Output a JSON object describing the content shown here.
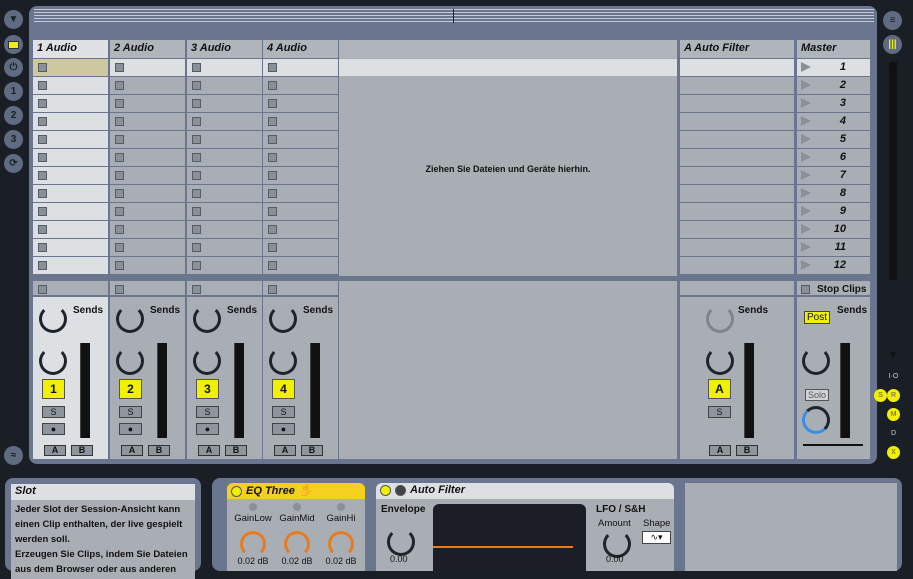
{
  "left_bar": {
    "icons": [
      "hide-browser-icon",
      "session-view-icon",
      "plugin-icon",
      "folder-1-icon",
      "folder-2-icon",
      "folder-3-icon",
      "sync-icon"
    ],
    "bottom_icon": "overview-wave-icon"
  },
  "right_bar": {
    "icons": [
      "arrangement-view-icon",
      "session-view-icon"
    ]
  },
  "tracks": [
    {
      "name": "1 Audio",
      "number": "1",
      "selected": true
    },
    {
      "name": "2 Audio",
      "number": "2",
      "selected": false
    },
    {
      "name": "3 Audio",
      "number": "3",
      "selected": false
    },
    {
      "name": "4 Audio",
      "number": "4",
      "selected": false
    }
  ],
  "drop_area": {
    "text": "Ziehen Sie Dateien und Geräte hierhin."
  },
  "return_track": {
    "name": "A Auto Filter",
    "button": "A"
  },
  "master": {
    "name": "Master",
    "stop_clips": "Stop Clips",
    "post": "Post",
    "solo": "Solo",
    "scenes": [
      "1",
      "2",
      "3",
      "4",
      "5",
      "6",
      "7",
      "8",
      "9",
      "10",
      "11",
      "12"
    ]
  },
  "mixer": {
    "sends_label": "Sends",
    "send_knob": "A",
    "solo_label": "S",
    "xfade_a": "A",
    "xfade_b": "B"
  },
  "mixer_toggles": [
    "I·O",
    "S",
    "R",
    "M",
    "D",
    "X"
  ],
  "info": {
    "title": "Slot",
    "lines": [
      "Jeder Slot der Session-Ansicht kann",
      "einen Clip enthalten, der live gespielt",
      "werden soll.",
      "Erzeugen Sie Clips, indem Sie Dateien",
      "aus dem Browser oder aus anderen"
    ]
  },
  "eq_three": {
    "title": "EQ Three",
    "params": [
      {
        "label": "GainLow",
        "value": "0.02 dB"
      },
      {
        "label": "GainMid",
        "value": "0.02 dB"
      },
      {
        "label": "GainHi",
        "value": "0.02 dB"
      }
    ]
  },
  "auto_filter": {
    "title": "Auto Filter",
    "envelope_label": "Envelope",
    "envelope_value": "0.00",
    "lfo_label": "LFO / S&H",
    "amount_label": "Amount",
    "amount_value": "0.00",
    "shape_label": "Shape"
  }
}
